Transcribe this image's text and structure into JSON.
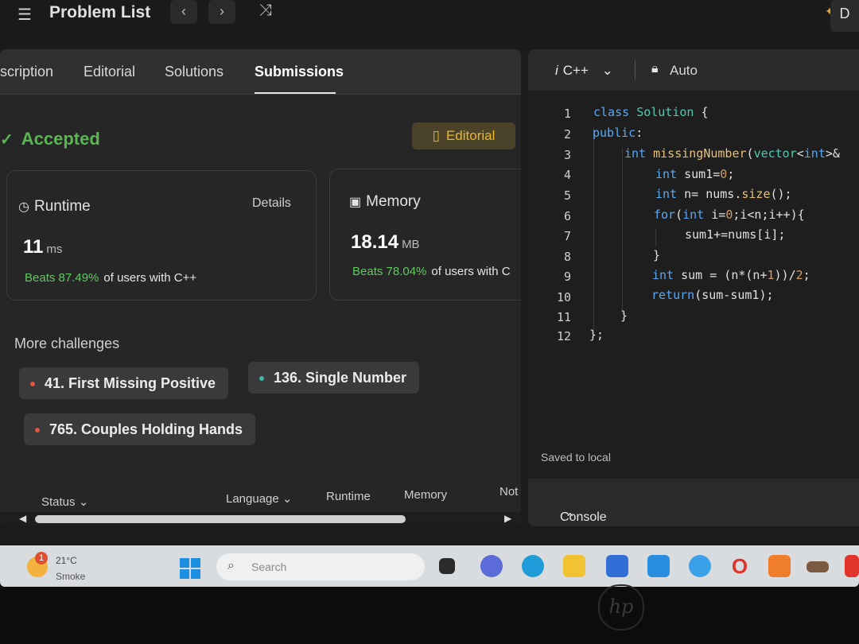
{
  "topbar": {
    "problem_list_label": "Problem List",
    "prev_label": "‹",
    "next_label": "›",
    "shuffle_label": "⤨",
    "right_label": "D"
  },
  "tabs": [
    {
      "label": "scription"
    },
    {
      "label": "Editorial"
    },
    {
      "label": "Solutions"
    },
    {
      "label": "Submissions"
    }
  ],
  "result": {
    "status": "Accepted",
    "editorial_button": "Editorial"
  },
  "runtime": {
    "title": "Runtime",
    "details_label": "Details",
    "value": "11",
    "unit": "ms",
    "beats_value": "Beats 87.49%",
    "beats_text": "of users with C++"
  },
  "memory": {
    "title": "Memory",
    "value": "18.14",
    "unit": "MB",
    "beats_value": "Beats 78.04%",
    "beats_text": "of users with C"
  },
  "more_challenges": {
    "title": "More challenges",
    "items": [
      {
        "label": "41. First Missing Positive",
        "dot_color": "#e0533d"
      },
      {
        "label": "136. Single Number",
        "dot_color": "#3fb8a9"
      },
      {
        "label": "765. Couples Holding Hands",
        "dot_color": "#e0533d"
      }
    ]
  },
  "table_headers": {
    "status": "Status",
    "language": "Language",
    "runtime": "Runtime",
    "memory": "Memory",
    "notes": "Not"
  },
  "editor": {
    "language": "C++",
    "mode": "Auto",
    "saved_text": "Saved to local",
    "console_label": "Console",
    "line_numbers": [
      "1",
      "2",
      "3",
      "4",
      "5",
      "6",
      "7",
      "8",
      "9",
      "10",
      "11",
      "12"
    ]
  },
  "taskbar": {
    "temperature": "21°C",
    "weather": "Smoke",
    "notification_count": "1",
    "search_placeholder": "Search"
  },
  "laptop_logo": "hp",
  "colors": {
    "accepted_green": "#5ab552",
    "beats_green": "#60c960",
    "editorial_gold": "#f0b429",
    "keyword_blue": "#5aa7f2"
  }
}
